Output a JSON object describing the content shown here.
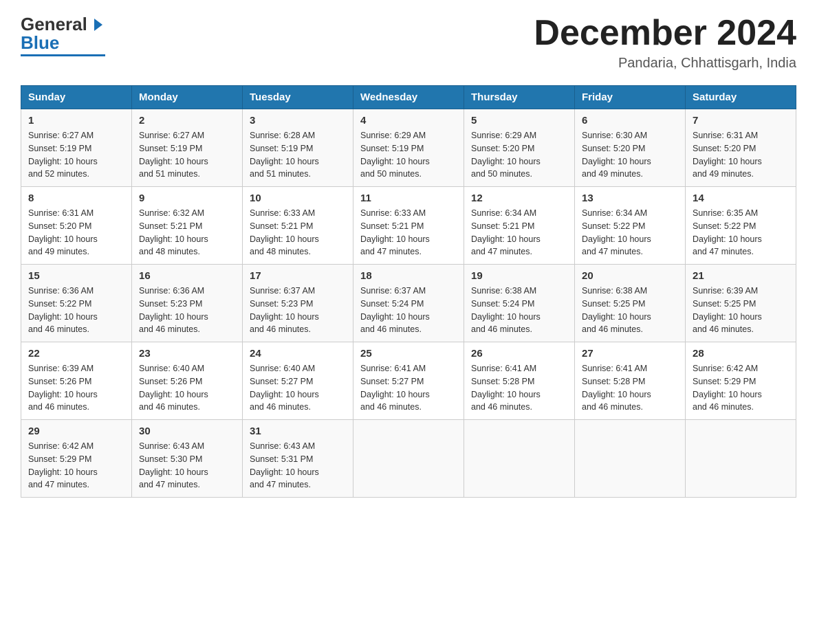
{
  "header": {
    "logo_general": "General",
    "logo_blue": "Blue",
    "month_year": "December 2024",
    "location": "Pandaria, Chhattisgarh, India"
  },
  "days_of_week": [
    "Sunday",
    "Monday",
    "Tuesday",
    "Wednesday",
    "Thursday",
    "Friday",
    "Saturday"
  ],
  "weeks": [
    [
      {
        "day": "1",
        "sunrise": "6:27 AM",
        "sunset": "5:19 PM",
        "daylight": "10 hours and 52 minutes."
      },
      {
        "day": "2",
        "sunrise": "6:27 AM",
        "sunset": "5:19 PM",
        "daylight": "10 hours and 51 minutes."
      },
      {
        "day": "3",
        "sunrise": "6:28 AM",
        "sunset": "5:19 PM",
        "daylight": "10 hours and 51 minutes."
      },
      {
        "day": "4",
        "sunrise": "6:29 AM",
        "sunset": "5:19 PM",
        "daylight": "10 hours and 50 minutes."
      },
      {
        "day": "5",
        "sunrise": "6:29 AM",
        "sunset": "5:20 PM",
        "daylight": "10 hours and 50 minutes."
      },
      {
        "day": "6",
        "sunrise": "6:30 AM",
        "sunset": "5:20 PM",
        "daylight": "10 hours and 49 minutes."
      },
      {
        "day": "7",
        "sunrise": "6:31 AM",
        "sunset": "5:20 PM",
        "daylight": "10 hours and 49 minutes."
      }
    ],
    [
      {
        "day": "8",
        "sunrise": "6:31 AM",
        "sunset": "5:20 PM",
        "daylight": "10 hours and 49 minutes."
      },
      {
        "day": "9",
        "sunrise": "6:32 AM",
        "sunset": "5:21 PM",
        "daylight": "10 hours and 48 minutes."
      },
      {
        "day": "10",
        "sunrise": "6:33 AM",
        "sunset": "5:21 PM",
        "daylight": "10 hours and 48 minutes."
      },
      {
        "day": "11",
        "sunrise": "6:33 AM",
        "sunset": "5:21 PM",
        "daylight": "10 hours and 47 minutes."
      },
      {
        "day": "12",
        "sunrise": "6:34 AM",
        "sunset": "5:21 PM",
        "daylight": "10 hours and 47 minutes."
      },
      {
        "day": "13",
        "sunrise": "6:34 AM",
        "sunset": "5:22 PM",
        "daylight": "10 hours and 47 minutes."
      },
      {
        "day": "14",
        "sunrise": "6:35 AM",
        "sunset": "5:22 PM",
        "daylight": "10 hours and 47 minutes."
      }
    ],
    [
      {
        "day": "15",
        "sunrise": "6:36 AM",
        "sunset": "5:22 PM",
        "daylight": "10 hours and 46 minutes."
      },
      {
        "day": "16",
        "sunrise": "6:36 AM",
        "sunset": "5:23 PM",
        "daylight": "10 hours and 46 minutes."
      },
      {
        "day": "17",
        "sunrise": "6:37 AM",
        "sunset": "5:23 PM",
        "daylight": "10 hours and 46 minutes."
      },
      {
        "day": "18",
        "sunrise": "6:37 AM",
        "sunset": "5:24 PM",
        "daylight": "10 hours and 46 minutes."
      },
      {
        "day": "19",
        "sunrise": "6:38 AM",
        "sunset": "5:24 PM",
        "daylight": "10 hours and 46 minutes."
      },
      {
        "day": "20",
        "sunrise": "6:38 AM",
        "sunset": "5:25 PM",
        "daylight": "10 hours and 46 minutes."
      },
      {
        "day": "21",
        "sunrise": "6:39 AM",
        "sunset": "5:25 PM",
        "daylight": "10 hours and 46 minutes."
      }
    ],
    [
      {
        "day": "22",
        "sunrise": "6:39 AM",
        "sunset": "5:26 PM",
        "daylight": "10 hours and 46 minutes."
      },
      {
        "day": "23",
        "sunrise": "6:40 AM",
        "sunset": "5:26 PM",
        "daylight": "10 hours and 46 minutes."
      },
      {
        "day": "24",
        "sunrise": "6:40 AM",
        "sunset": "5:27 PM",
        "daylight": "10 hours and 46 minutes."
      },
      {
        "day": "25",
        "sunrise": "6:41 AM",
        "sunset": "5:27 PM",
        "daylight": "10 hours and 46 minutes."
      },
      {
        "day": "26",
        "sunrise": "6:41 AM",
        "sunset": "5:28 PM",
        "daylight": "10 hours and 46 minutes."
      },
      {
        "day": "27",
        "sunrise": "6:41 AM",
        "sunset": "5:28 PM",
        "daylight": "10 hours and 46 minutes."
      },
      {
        "day": "28",
        "sunrise": "6:42 AM",
        "sunset": "5:29 PM",
        "daylight": "10 hours and 46 minutes."
      }
    ],
    [
      {
        "day": "29",
        "sunrise": "6:42 AM",
        "sunset": "5:29 PM",
        "daylight": "10 hours and 47 minutes."
      },
      {
        "day": "30",
        "sunrise": "6:43 AM",
        "sunset": "5:30 PM",
        "daylight": "10 hours and 47 minutes."
      },
      {
        "day": "31",
        "sunrise": "6:43 AM",
        "sunset": "5:31 PM",
        "daylight": "10 hours and 47 minutes."
      },
      null,
      null,
      null,
      null
    ]
  ],
  "labels": {
    "sunrise": "Sunrise:",
    "sunset": "Sunset:",
    "daylight": "Daylight:"
  }
}
